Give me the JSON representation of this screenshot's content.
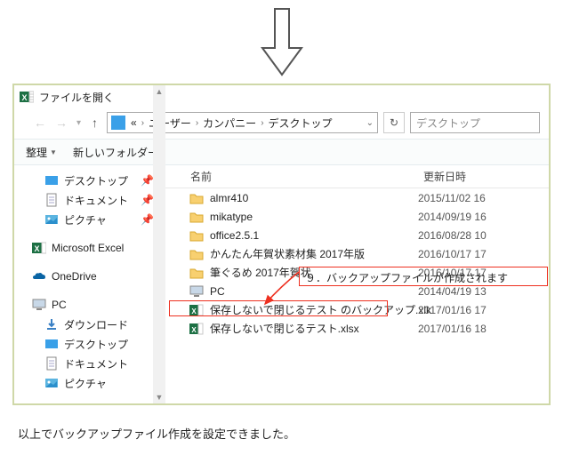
{
  "window": {
    "title": "ファイルを開く"
  },
  "breadcrumb": {
    "seg0_glyph": "«",
    "seg1": "ユーザー",
    "seg2": "カンパニー",
    "seg3": "デスクトップ"
  },
  "search": {
    "placeholder": "デスクトップ"
  },
  "toolbar": {
    "organize": "整理",
    "newfolder": "新しいフォルダー"
  },
  "nav": {
    "desktop": "デスクトップ",
    "documents": "ドキュメント",
    "pictures": "ピクチャ",
    "excel": "Microsoft Excel",
    "onedrive": "OneDrive",
    "pc": "PC",
    "downloads": "ダウンロード",
    "desktop2": "デスクトップ",
    "documents2": "ドキュメント",
    "pictures2": "ピクチャ"
  },
  "columns": {
    "name": "名前",
    "modified": "更新日時"
  },
  "files": [
    {
      "name": "almr410",
      "date": "2015/11/02 16",
      "type": "folder"
    },
    {
      "name": "mikatype",
      "date": "2014/09/19 16",
      "type": "folder"
    },
    {
      "name": "office2.5.1",
      "date": "2016/08/28 10",
      "type": "folder"
    },
    {
      "name": "かんたん年賀状素材集 2017年版",
      "date": "2016/10/17 17",
      "type": "folder"
    },
    {
      "name": "筆ぐるめ 2017年賀状",
      "date": "2016/10/17 17",
      "type": "folder"
    },
    {
      "name": "PC",
      "date": "2014/04/19 13",
      "type": "pc"
    },
    {
      "name": "保存しないで閉じるテスト のバックアップ.xlk",
      "date": "2017/01/16 17",
      "type": "excel"
    },
    {
      "name": "保存しないで閉じるテスト.xlsx",
      "date": "2017/01/16 18",
      "type": "excel"
    }
  ],
  "callout": {
    "text": "９．バックアップファイルが作成されます"
  },
  "footer": {
    "text": "以上でバックアップファイル作成を設定できました。"
  }
}
